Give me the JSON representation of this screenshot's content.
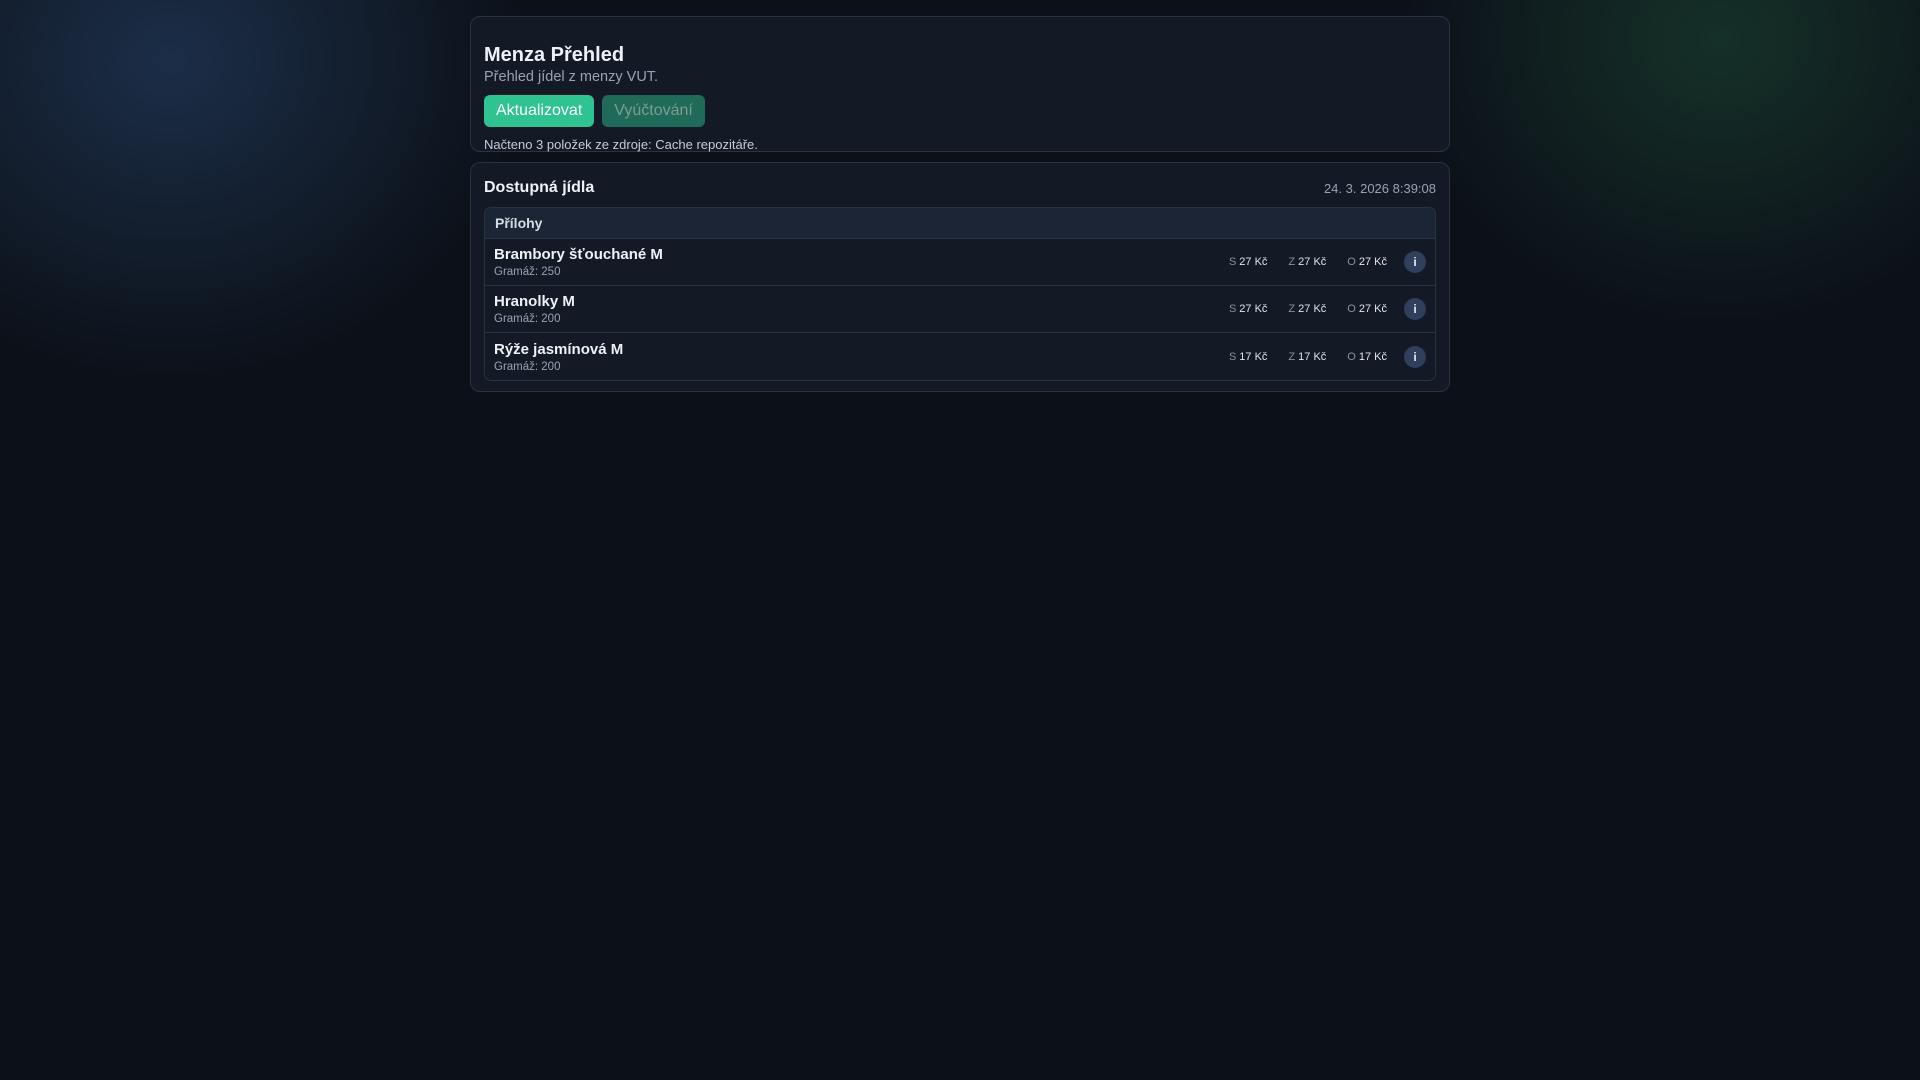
{
  "header": {
    "title": "Menza Přehled",
    "subtitle": "Přehled jídel z menzy VUT.",
    "refresh_label": "Aktualizovat",
    "billing_label": "Vyúčtování",
    "status": "Načteno 3 položek ze zdroje: Cache repozitáře."
  },
  "meals": {
    "title": "Dostupná jídla",
    "timestamp": "24. 3. 2026 8:39:08",
    "category": "Přílohy",
    "price_labels": {
      "s": "S",
      "z": "Z",
      "o": "O"
    },
    "info_label": "i",
    "items": [
      {
        "name": "Brambory šťouchané M",
        "weight": "Gramáž: 250",
        "s": "27 Kč",
        "z": "27 Kč",
        "o": "27 Kč"
      },
      {
        "name": "Hranolky M",
        "weight": "Gramáž: 200",
        "s": "27 Kč",
        "z": "27 Kč",
        "o": "27 Kč"
      },
      {
        "name": "Rýže jasmínová M",
        "weight": "Gramáž: 200",
        "s": "17 Kč",
        "z": "17 Kč",
        "o": "17 Kč"
      }
    ]
  }
}
